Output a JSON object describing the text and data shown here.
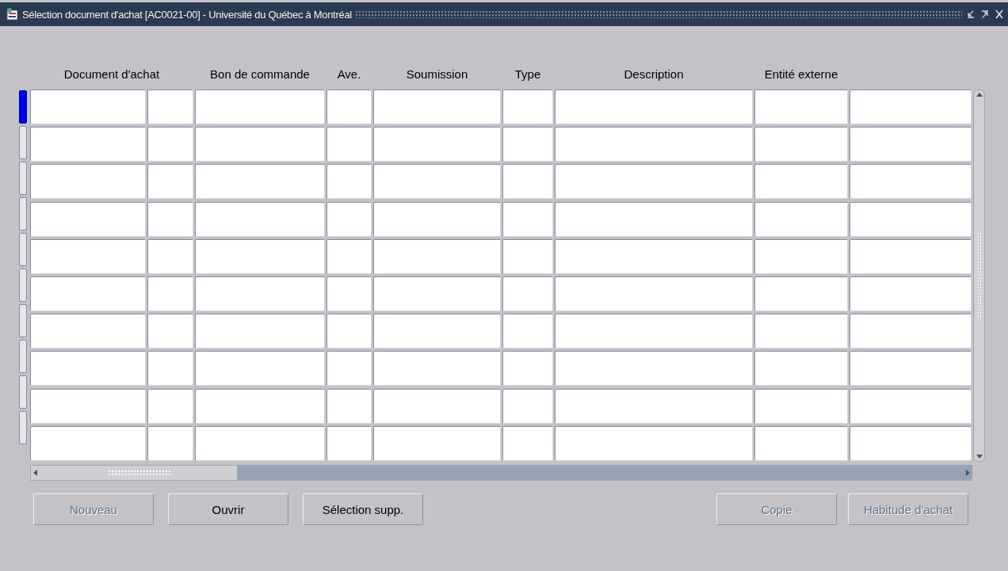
{
  "window": {
    "title": "Sélection document d'achat [AC0021-00] - Université du Québec à Montréal"
  },
  "table": {
    "headers": [
      "Document d'achat",
      "Bon de commande",
      "Ave.",
      "Soumission",
      "Type",
      "Description",
      "Entité externe"
    ],
    "rows": [
      {
        "selected": true
      },
      {
        "selected": false
      },
      {
        "selected": false
      },
      {
        "selected": false
      },
      {
        "selected": false
      },
      {
        "selected": false
      },
      {
        "selected": false
      },
      {
        "selected": false
      },
      {
        "selected": false
      },
      {
        "selected": false
      }
    ]
  },
  "left_buttons": [
    {
      "label": "Nouveau",
      "disabled": true
    },
    {
      "label": "Ouvrir",
      "disabled": false
    },
    {
      "label": "Sélection supp.",
      "disabled": false
    }
  ],
  "right_buttons": [
    {
      "label": "Copie",
      "disabled": true
    },
    {
      "label": "Habitude d'achat",
      "disabled": true
    }
  ]
}
